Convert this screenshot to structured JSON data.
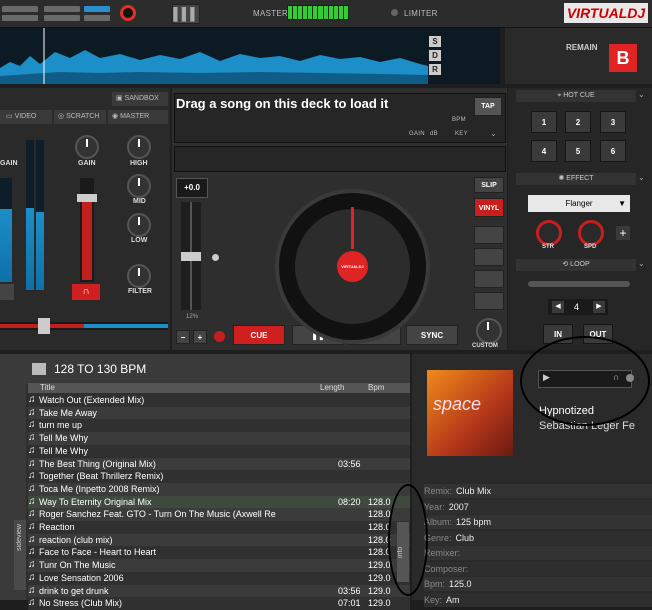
{
  "top_bar": {
    "master_label": "MASTER",
    "limiter_label": "LIMITER",
    "logo_text": "VIRTUALDJ"
  },
  "waveform": {
    "sdr": [
      "S",
      "D",
      "R"
    ]
  },
  "deck_right": {
    "remain_label": "REMAIN",
    "deck_letter": "B"
  },
  "mixer": {
    "sandbox_label": "SANDBOX",
    "tabs": [
      "VIDEO",
      "SCRATCH",
      "MASTER"
    ],
    "gain_left": "GAIN",
    "gain": "GAIN",
    "eq": [
      "HIGH",
      "MID",
      "LOW"
    ],
    "filter": "FILTER"
  },
  "deck": {
    "load_text": "Drag a song on this deck to load it",
    "tap_label": "TAP",
    "bpm_label": "BPM",
    "gain_label": "GAIN",
    "db_label": "dB",
    "key_label": "KEY",
    "pitch_value": "+0.0",
    "pitch_range": "12%",
    "slip_label": "SLIP",
    "vinyl_label": "VINYL",
    "cue_label": "CUE",
    "sync_label": "SYNC",
    "custom_label": "CUSTOM",
    "platter_label": "VIRTUALDJ"
  },
  "right_panel": {
    "hotcue_title": "HOT CUE",
    "hotcues": [
      "1",
      "2",
      "3",
      "4",
      "5",
      "6"
    ],
    "effect_title": "EFFECT",
    "effect_selected": "Flanger",
    "str_label": "STR",
    "spd_label": "SPD",
    "loop_title": "LOOP",
    "loop_value": "4",
    "in_label": "IN",
    "out_label": "OUT"
  },
  "browser": {
    "folder": "128 TO 130 BPM",
    "columns": [
      "Title",
      "Length",
      "Bpm"
    ],
    "rows": [
      {
        "title": "Watch Out (Extended Mix)",
        "length": "",
        "bpm": ""
      },
      {
        "title": "Take Me Away",
        "length": "",
        "bpm": ""
      },
      {
        "title": "turn me up",
        "length": "",
        "bpm": ""
      },
      {
        "title": "Tell Me Why",
        "length": "",
        "bpm": ""
      },
      {
        "title": "Tell Me Why",
        "length": "",
        "bpm": ""
      },
      {
        "title": "The Best Thing (Original Mix)",
        "length": "03:56",
        "bpm": ""
      },
      {
        "title": "Together (Beat Thrillerz Remix)",
        "length": "",
        "bpm": ""
      },
      {
        "title": "Toca Me (Inpetto 2008 Remix)",
        "length": "",
        "bpm": ""
      },
      {
        "title": "Way To Eternity Original Mix",
        "length": "08:20",
        "bpm": "128.0"
      },
      {
        "title": "Roger Sanchez Feat. GTO - Turn On The Music (Axwell Re",
        "length": "",
        "bpm": "128.0"
      },
      {
        "title": "Reaction",
        "length": "",
        "bpm": "128.0"
      },
      {
        "title": "reaction (club mix)",
        "length": "",
        "bpm": "128.0"
      },
      {
        "title": "Face to Face - Heart to Heart",
        "length": "",
        "bpm": "128.0"
      },
      {
        "title": "Tunr On The Music",
        "length": "",
        "bpm": "129.0"
      },
      {
        "title": "Love Sensation 2006",
        "length": "",
        "bpm": "129.0"
      },
      {
        "title": "drink to get drunk",
        "length": "03:56",
        "bpm": "129.0"
      },
      {
        "title": "No Stress (Club Mix)",
        "length": "07:01",
        "bpm": "129.0"
      }
    ],
    "sideview_label": "sideview",
    "info_tab_label": "info"
  },
  "info": {
    "cover_text": "space",
    "title": "Hypnotized",
    "artist": "Sebastian Leger Fe",
    "fields": [
      {
        "key": "Remix:",
        "value": "Club Mix"
      },
      {
        "key": "Year:",
        "value": "2007"
      },
      {
        "key": "Album:",
        "value": "125 bpm"
      },
      {
        "key": "Genre:",
        "value": "Club"
      },
      {
        "key": "Remixer:",
        "value": ""
      },
      {
        "key": "Composer:",
        "value": ""
      },
      {
        "key": "Bpm:",
        "value": "125.0"
      },
      {
        "key": "Key:",
        "value": "Am"
      }
    ]
  },
  "colors": {
    "accent_red": "#e02424",
    "wave_blue": "#1c8ec8",
    "meter_green": "#33cc33"
  }
}
